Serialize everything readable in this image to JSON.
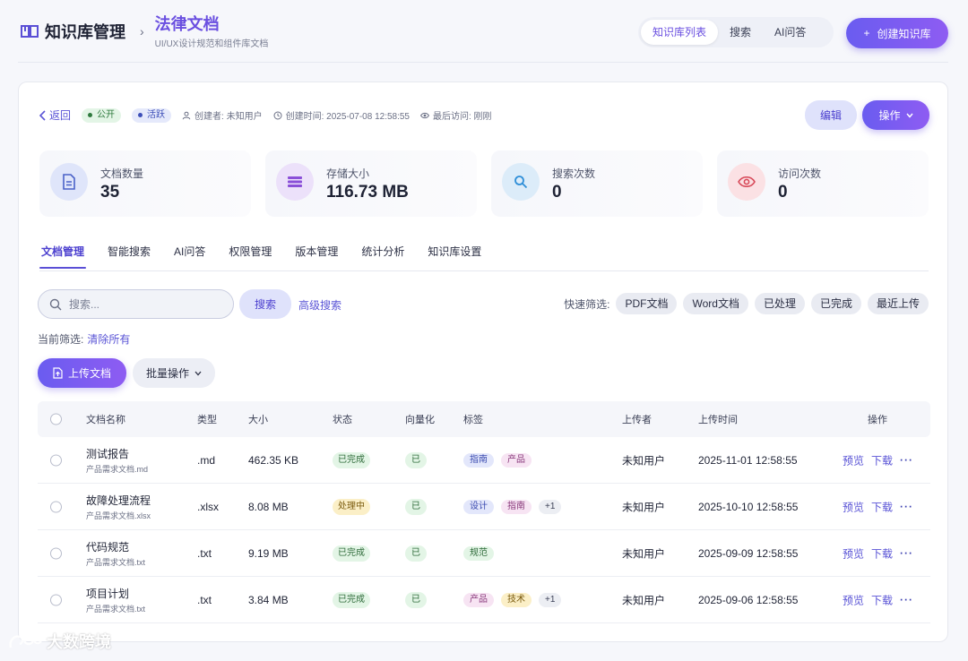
{
  "header": {
    "app_title": "知识库管理",
    "crumb_sep": "›",
    "kb_title": "法律文档",
    "kb_subtitle": "UI/UX设计规范和组件库文档",
    "nav": [
      "知识库列表",
      "搜索",
      "AI问答"
    ],
    "create_label": "创建知识库",
    "create_icon": "+"
  },
  "meta": {
    "back_label": "返回",
    "badge_public": "公开",
    "badge_active": "活跃",
    "creator": "创建者: 未知用户",
    "created": "创建时间: 2025-07-08 12:58:55",
    "last_visit": "最后访问: 刚刚"
  },
  "actions": {
    "edit_label": "编辑",
    "op_label": "操作"
  },
  "stats": [
    {
      "label": "文档数量",
      "value": "35",
      "icon": "document-icon",
      "color": "#4a62c8"
    },
    {
      "label": "存储大小",
      "value": "116.73 MB",
      "icon": "database-icon",
      "color": "#8a4fd8"
    },
    {
      "label": "搜索次数",
      "value": "0",
      "icon": "search-icon",
      "color": "#2f8fd8"
    },
    {
      "label": "访问次数",
      "value": "0",
      "icon": "eye-icon",
      "color": "#d84a5a"
    }
  ],
  "tabs": [
    "文档管理",
    "智能搜索",
    "AI问答",
    "权限管理",
    "版本管理",
    "统计分析",
    "知识库设置"
  ],
  "search": {
    "placeholder": "搜索...",
    "button_label": "搜索",
    "advanced_label": "高级搜索",
    "quick_label": "快速筛选:",
    "quick_chips": [
      "PDF文档",
      "Word文档",
      "已处理",
      "已完成",
      "最近上传"
    ],
    "current_filter_label": "当前筛选:",
    "clear_label": "清除所有"
  },
  "toolbar": {
    "upload_label": "上传文档",
    "batch_label": "批量操作"
  },
  "table": {
    "headers": [
      "文档名称",
      "类型",
      "大小",
      "状态",
      "向量化",
      "标签",
      "上传者",
      "上传时间",
      "操作"
    ],
    "rows": [
      {
        "name": "测试报告",
        "file": "产品需求文档.md",
        "type": ".md",
        "size": "462.35 KB",
        "status": "已完成",
        "vec": "已",
        "tags": [
          "指南",
          "产品"
        ],
        "more": "",
        "uploader": "未知用户",
        "time": "2025-11-01 12:58:55"
      },
      {
        "name": "故障处理流程",
        "file": "产品需求文档.xlsx",
        "type": ".xlsx",
        "size": "8.08 MB",
        "status": "处理中",
        "vec": "已",
        "tags": [
          "设计",
          "指南"
        ],
        "more": "+1",
        "uploader": "未知用户",
        "time": "2025-10-10 12:58:55"
      },
      {
        "name": "代码规范",
        "file": "产品需求文档.txt",
        "type": ".txt",
        "size": "9.19 MB",
        "status": "已完成",
        "vec": "已",
        "tags": [
          "规范"
        ],
        "more": "",
        "uploader": "未知用户",
        "time": "2025-09-09 12:58:55"
      },
      {
        "name": "项目计划",
        "file": "产品需求文档.txt",
        "type": ".txt",
        "size": "3.84 MB",
        "status": "已完成",
        "vec": "已",
        "tags": [
          "产品",
          "技术"
        ],
        "more": "+1",
        "uploader": "未知用户",
        "time": "2025-09-06 12:58:55"
      }
    ],
    "row_actions": {
      "preview": "预览",
      "download": "下载",
      "more": "···"
    }
  },
  "watermark": "大数跨境"
}
